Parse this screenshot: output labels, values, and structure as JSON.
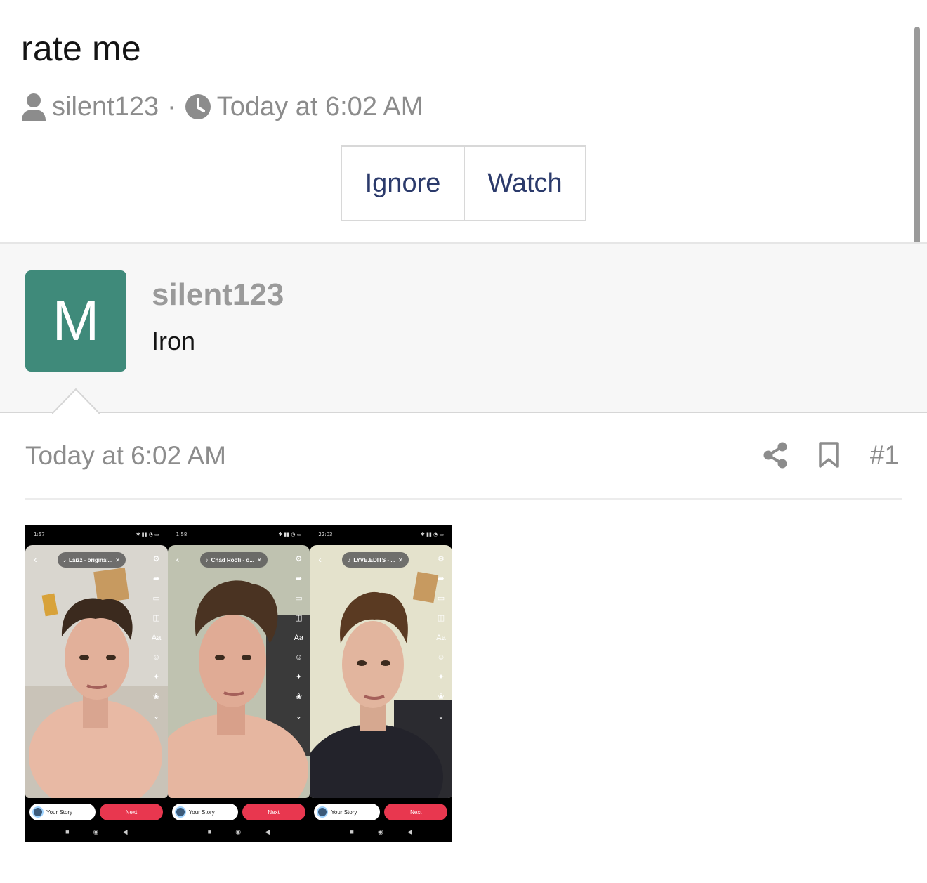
{
  "thread": {
    "title": "rate me",
    "author": "silent123",
    "separator": "·",
    "date": "Today at 6:02 AM",
    "buttons": {
      "ignore": "Ignore",
      "watch": "Watch"
    }
  },
  "user": {
    "avatar_letter": "M",
    "avatar_color": "#3f8a7a",
    "name": "silent123",
    "title": "Iron"
  },
  "post": {
    "date": "Today at 6:02 AM",
    "number": "#1",
    "icons": [
      "share-icon",
      "bookmark-icon"
    ]
  },
  "attachment": {
    "frames": [
      {
        "time": "1:57",
        "sound": "Laizz - original...",
        "story_label": "Your Story",
        "next_label": "Next",
        "shirt": "none"
      },
      {
        "time": "1:58",
        "sound": "Chad Roofi - o...",
        "story_label": "Your Story",
        "next_label": "Next",
        "shirt": "none"
      },
      {
        "time": "22:03",
        "sound": "LYVE.EDITS - ...",
        "story_label": "Your Story",
        "next_label": "Next",
        "shirt": "dark"
      }
    ],
    "text_tool": "Aa"
  }
}
